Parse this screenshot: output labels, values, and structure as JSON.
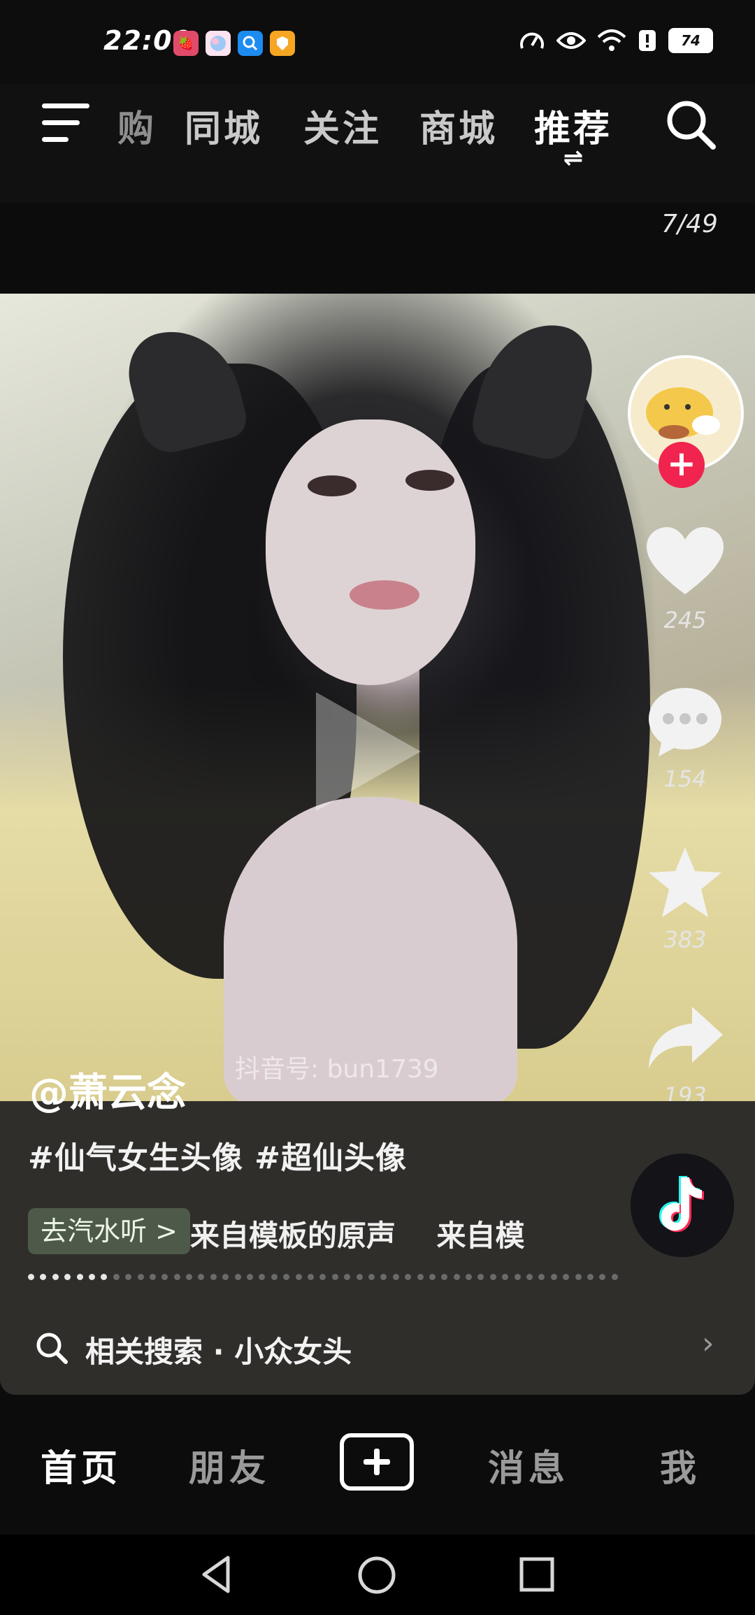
{
  "status_bar": {
    "time": "22:00",
    "battery": "74",
    "icons": [
      "speed-icon",
      "eye-icon",
      "wifi-icon",
      "notification-icon",
      "battery-icon"
    ],
    "app_icons": [
      "app-strawberry-icon",
      "app-bubble-icon",
      "app-search-icon",
      "app-tag-icon"
    ]
  },
  "top_nav": {
    "tabs": [
      {
        "label": "购",
        "active": false
      },
      {
        "label": "同城",
        "active": false
      },
      {
        "label": "关注",
        "active": false
      },
      {
        "label": "商城",
        "active": false
      },
      {
        "label": "推荐",
        "active": true
      }
    ],
    "switch_glyph": "⇌"
  },
  "counter": "7/49",
  "video": {
    "watermark": "抖音号: bun1739"
  },
  "actions": {
    "likes": "245",
    "comments": "154",
    "favorites": "383",
    "shares": "193"
  },
  "post": {
    "author": "@萧云念",
    "caption": "#仙气女生头像 #超仙头像",
    "music_chip": "去汽水听 >",
    "music_text": "来自模板的原声    来自模",
    "related_prefix": "相关搜索 · ",
    "related_query": "小众女头"
  },
  "bottom_nav": {
    "home": "首页",
    "friends": "朋友",
    "messages": "消息",
    "me": "我"
  },
  "colors": {
    "accent_red": "#f0244e",
    "music_chip": "#4d5a4a",
    "panel": "#2f2e2b"
  }
}
